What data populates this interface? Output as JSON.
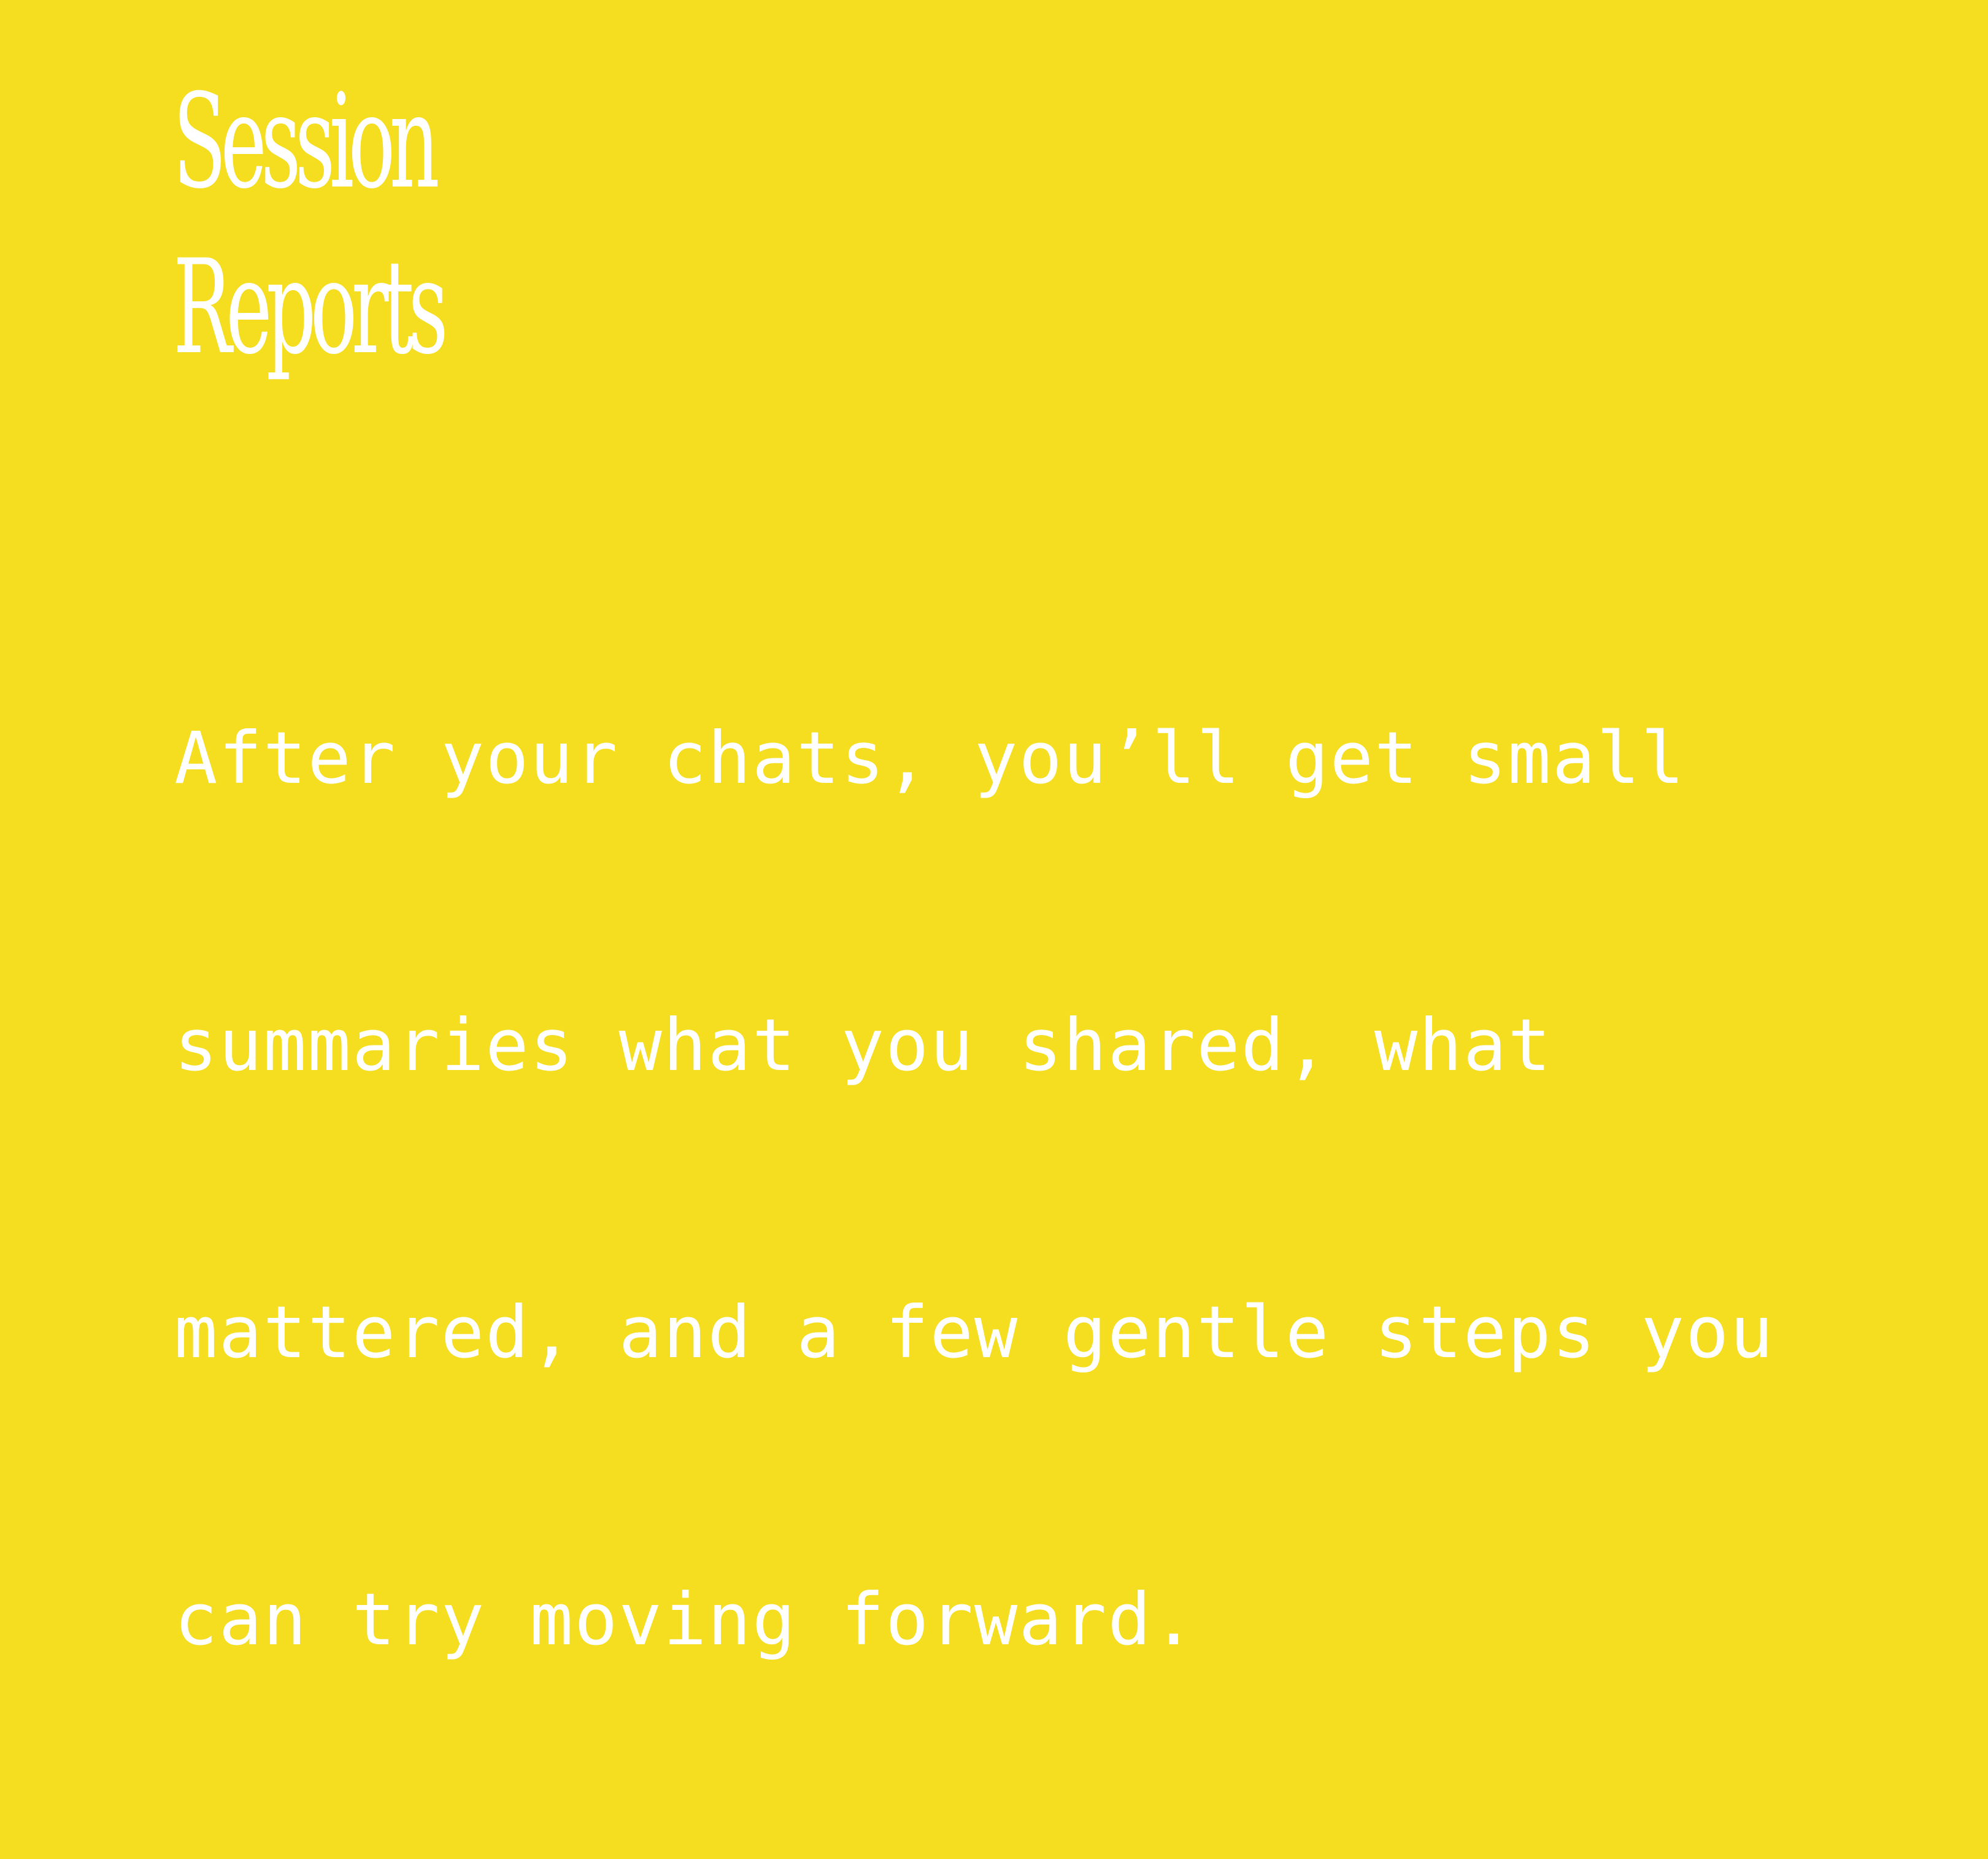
{
  "colors": {
    "background": "#f5dd1f",
    "text": "#ffffff"
  },
  "title": {
    "lines": [
      "Session",
      "Reports"
    ]
  },
  "description": {
    "lines": [
      "After your chats, you’ll get small",
      "summaries what you shared, what",
      "mattered, and a few gentle steps you",
      "can try moving forward."
    ]
  }
}
